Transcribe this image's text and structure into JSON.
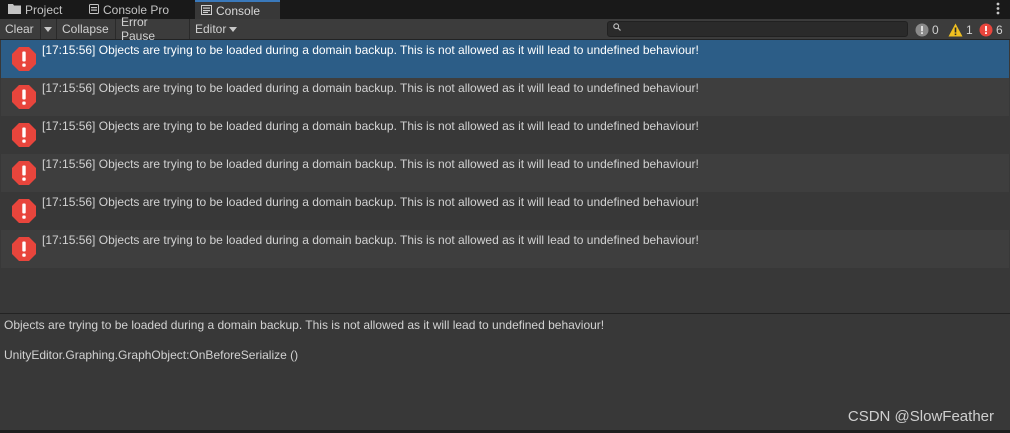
{
  "tabs": [
    {
      "label": "Project",
      "icon": "folder-icon"
    },
    {
      "label": "Console Pro",
      "icon": "console-pro-icon"
    },
    {
      "label": "Console",
      "icon": "console-icon",
      "active": true
    }
  ],
  "toolbar": {
    "clear_label": "Clear",
    "collapse_label": "Collapse",
    "error_pause_label": "Error Pause",
    "editor_label": "Editor",
    "search": {
      "value": "",
      "placeholder": ""
    },
    "counts": {
      "info": "0",
      "warning": "1",
      "error": "6"
    }
  },
  "colors": {
    "error_red": "#e8453c",
    "warning_yellow": "#f0c020",
    "info_gray": "#8a8a8a",
    "selection_blue": "#2c5d87",
    "tab_accent": "#3a79bb"
  },
  "log_entries": [
    {
      "time": "[17:15:56]",
      "text": "Objects are trying to be loaded during a domain backup. This is not allowed as it will lead to undefined behaviour!",
      "type": "error",
      "selected": true
    },
    {
      "time": "[17:15:56]",
      "text": "Objects are trying to be loaded during a domain backup. This is not allowed as it will lead to undefined behaviour!",
      "type": "error"
    },
    {
      "time": "[17:15:56]",
      "text": "Objects are trying to be loaded during a domain backup. This is not allowed as it will lead to undefined behaviour!",
      "type": "error"
    },
    {
      "time": "[17:15:56]",
      "text": "Objects are trying to be loaded during a domain backup. This is not allowed as it will lead to undefined behaviour!",
      "type": "error"
    },
    {
      "time": "[17:15:56]",
      "text": "Objects are trying to be loaded during a domain backup. This is not allowed as it will lead to undefined behaviour!",
      "type": "error"
    },
    {
      "time": "[17:15:56]",
      "text": "Objects are trying to be loaded during a domain backup. This is not allowed as it will lead to undefined behaviour!",
      "type": "error"
    }
  ],
  "detail": {
    "message": "Objects are trying to be loaded during a domain backup. This is not allowed as it will lead to undefined behaviour!",
    "stack": "UnityEditor.Graphing.GraphObject:OnBeforeSerialize ()"
  },
  "watermark": "CSDN @SlowFeather"
}
